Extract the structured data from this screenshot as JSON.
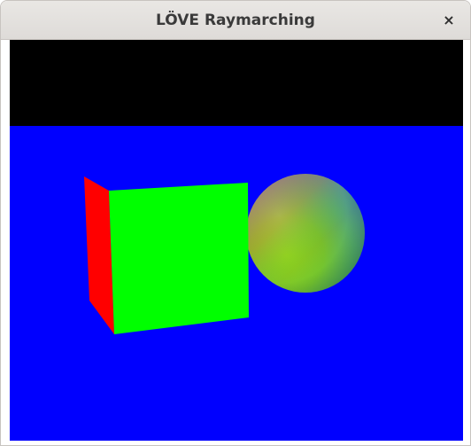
{
  "window": {
    "title": "LÖVE Raymarching",
    "close_glyph": "×",
    "close_icon": "close-icon"
  },
  "scene": {
    "colors": {
      "sky": "#000000",
      "floor": "#0000ff",
      "cube_front": "#00ff00",
      "cube_side": "#ff0000"
    }
  }
}
